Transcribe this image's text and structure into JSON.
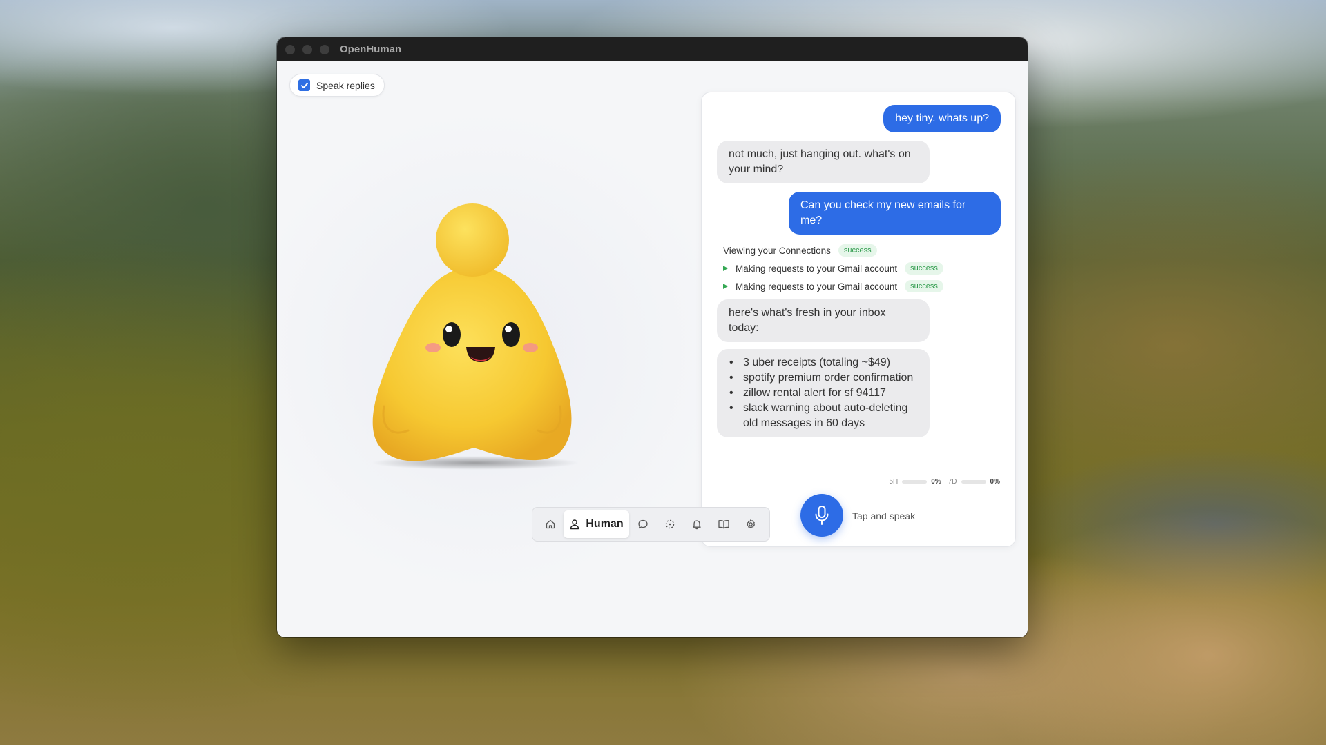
{
  "window": {
    "title": "OpenHuman"
  },
  "speak_toggle": {
    "label": "Speak replies",
    "checked": true
  },
  "chat": {
    "messages": [
      {
        "role": "user",
        "text": "hey tiny. whats up?"
      },
      {
        "role": "assistant",
        "text": "not much, just hanging out. what's on your mind?"
      },
      {
        "role": "user",
        "text": "Can you check my new emails for me?"
      }
    ],
    "tool_calls": [
      {
        "label": "Viewing your Connections",
        "status": "success",
        "expandable": false
      },
      {
        "label": "Making requests to your Gmail account",
        "status": "success",
        "expandable": true
      },
      {
        "label": "Making requests to your Gmail account",
        "status": "success",
        "expandable": true
      }
    ],
    "reply_intro": "here's what's fresh in your inbox today:",
    "reply_items": [
      "3 uber receipts (totaling ~$49)",
      "spotify premium order confirmation",
      "zillow rental alert for sf 94117",
      "slack warning about auto-deleting old messages in 60 days"
    ]
  },
  "composer": {
    "usage": [
      {
        "label": "5H",
        "value": "0%",
        "fraction": 0
      },
      {
        "label": "7D",
        "value": "0%",
        "fraction": 0
      }
    ],
    "mic_hint": "Tap and speak"
  },
  "nav": {
    "items": [
      {
        "name": "home",
        "icon": "home-icon"
      },
      {
        "name": "human",
        "icon": "user-icon",
        "label": "Human",
        "active": true
      },
      {
        "name": "chat",
        "icon": "chat-bubble-icon"
      },
      {
        "name": "skills",
        "icon": "dotted-circle-icon"
      },
      {
        "name": "notifications",
        "icon": "bell-icon"
      },
      {
        "name": "library",
        "icon": "book-icon"
      },
      {
        "name": "settings",
        "icon": "gear-icon"
      }
    ]
  },
  "colors": {
    "accent": "#2d6ce6",
    "success_text": "#2f9b4c",
    "success_bg": "#e6f6ea",
    "mascot": "#f6c831"
  }
}
